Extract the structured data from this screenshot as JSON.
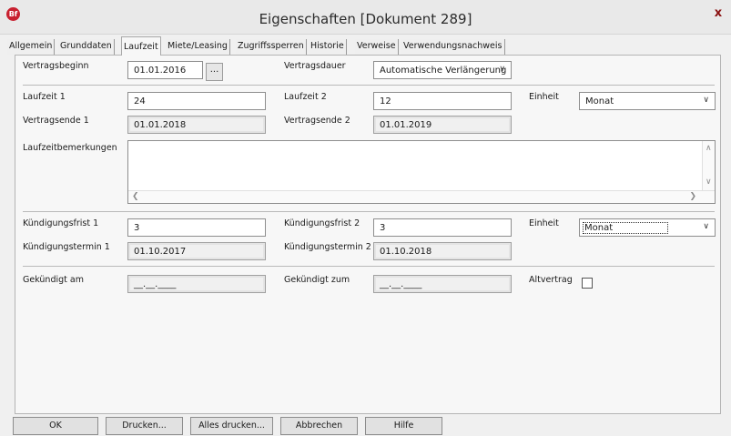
{
  "window": {
    "app_icon": "Bf",
    "title": "Eigenschaften [Dokument 289]",
    "close": "x"
  },
  "tabs": [
    {
      "label": "Allgemein",
      "active": false
    },
    {
      "label": "Grunddaten",
      "active": false
    },
    {
      "label": "Laufzeit",
      "active": true
    },
    {
      "label": "Miete/Leasing",
      "active": false
    },
    {
      "label": "Zugriffssperren",
      "active": false
    },
    {
      "label": "Historie",
      "active": false
    },
    {
      "label": "Verweise",
      "active": false
    },
    {
      "label": "Verwendungsnachweis",
      "active": false
    }
  ],
  "form": {
    "vertragsbeginn": {
      "label": "Vertragsbeginn",
      "value": "01.01.2016",
      "picker": "..."
    },
    "vertragsdauer": {
      "label": "Vertragsdauer",
      "value": "Automatische Verlängerung"
    },
    "laufzeit1": {
      "label": "Laufzeit 1",
      "value": "24"
    },
    "laufzeit2": {
      "label": "Laufzeit 2",
      "value": "12"
    },
    "einheit1": {
      "label": "Einheit",
      "value": "Monat"
    },
    "vertragsende1": {
      "label": "Vertragsende 1",
      "value": "01.01.2018"
    },
    "vertragsende2": {
      "label": "Vertragsende 2",
      "value": "01.01.2019"
    },
    "laufzeitbemerkungen": {
      "label": "Laufzeitbemerkungen",
      "value": ""
    },
    "kuendigungsfrist1": {
      "label": "Kündigungsfrist 1",
      "value": "3"
    },
    "kuendigungsfrist2": {
      "label": "Kündigungsfrist 2",
      "value": "3"
    },
    "einheit2": {
      "label": "Einheit",
      "value": "Monat"
    },
    "kuendigungstermin1": {
      "label": "Kündigungstermin 1",
      "value": "01.10.2017"
    },
    "kuendigungstermin2": {
      "label": "Kündigungstermin 2",
      "value": "01.10.2018"
    },
    "gekuendigt_am": {
      "label": "Gekündigt am",
      "value": "__.__.____"
    },
    "gekuendigt_zum": {
      "label": "Gekündigt zum",
      "value": "__.__.____"
    },
    "altvertrag": {
      "label": "Altvertrag",
      "checked": false
    }
  },
  "buttons": {
    "ok": "OK",
    "drucken": "Drucken...",
    "alles_drucken": "Alles drucken...",
    "abbrechen": "Abbrechen",
    "hilfe": "Hilfe"
  },
  "icons": {
    "chevron": "chevron-down-icon",
    "scroll_up": "arrow-up-icon",
    "scroll_down": "arrow-down-icon",
    "scroll_left": "arrow-left-icon",
    "scroll_right": "arrow-right-icon"
  },
  "colors": {
    "app_icon_red": "#c8202f",
    "window_bg": "#f0f0f0",
    "panel_bg": "#f7f7f7"
  }
}
